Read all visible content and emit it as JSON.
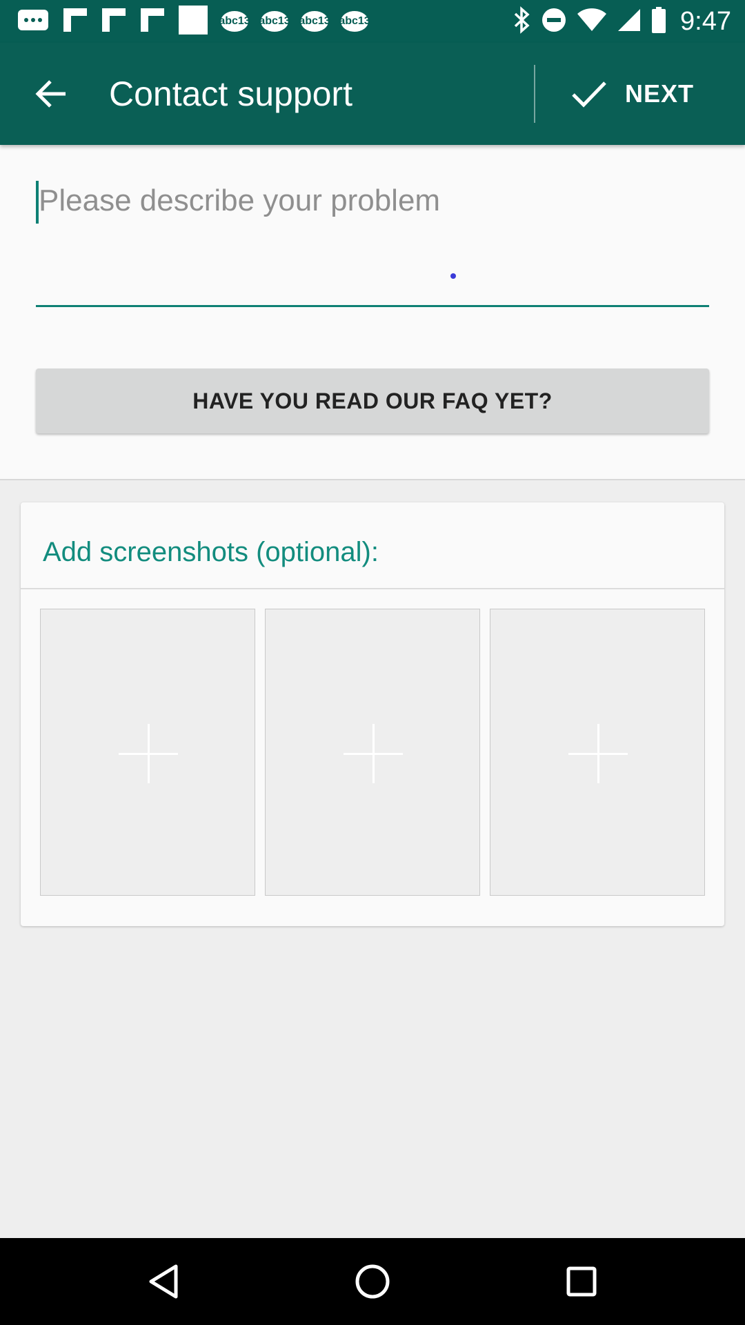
{
  "status_bar": {
    "time": "9:47",
    "badge_text": "abc13",
    "icons": [
      "message-icon",
      "flipboard-icon",
      "flipboard-icon",
      "flipboard-icon",
      "blank-icon",
      "abc13-icon",
      "abc13-icon",
      "abc13-icon",
      "abc13-icon",
      "bluetooth-icon",
      "do-not-disturb-icon",
      "wifi-icon",
      "signal-icon",
      "battery-icon"
    ]
  },
  "app_bar": {
    "title": "Contact support",
    "next_label": "NEXT",
    "back_icon": "arrow-left-icon",
    "check_icon": "check-icon"
  },
  "description": {
    "placeholder": "Please describe your problem",
    "value": ""
  },
  "faq": {
    "label": "HAVE YOU READ OUR FAQ YET?"
  },
  "screenshots": {
    "title": "Add screenshots (optional):",
    "slots": [
      {
        "icon": "plus-icon"
      },
      {
        "icon": "plus-icon"
      },
      {
        "icon": "plus-icon"
      }
    ]
  },
  "nav_bar": {
    "icons": [
      "back-triangle-icon",
      "home-circle-icon",
      "recents-square-icon"
    ]
  },
  "colors": {
    "app_bar": "#0a5f55",
    "accent": "#128c7e",
    "background": "#eeeeee"
  }
}
